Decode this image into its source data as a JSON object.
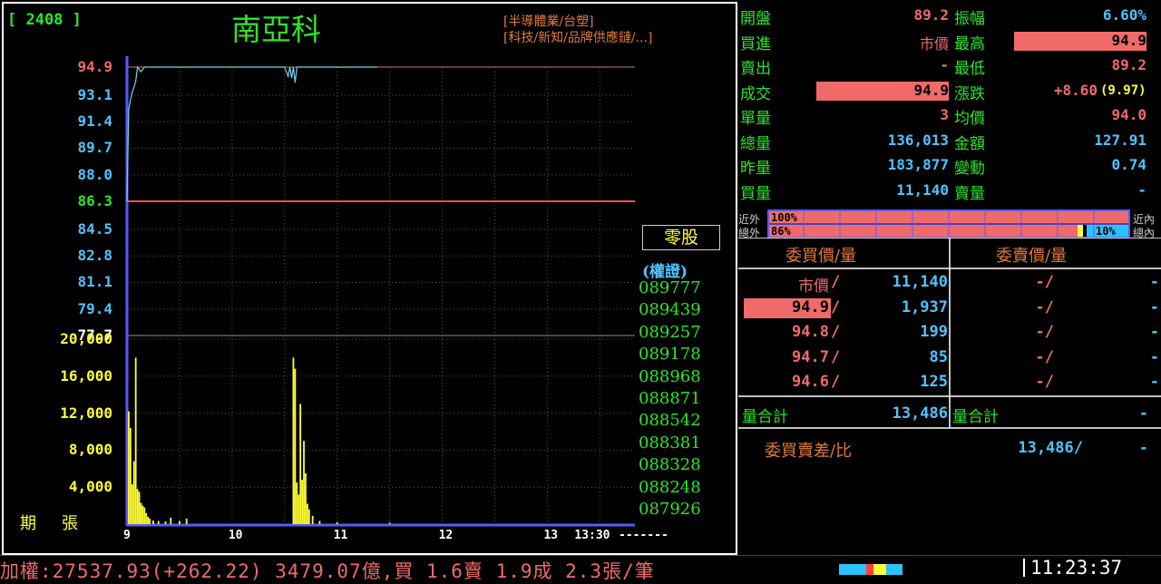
{
  "stock": {
    "code": "[ 2408 ]",
    "name": "南亞科",
    "cat1": "[半導體業/台塑]",
    "cat2": "[科技/新知/品牌供應鏈/...]"
  },
  "chart_data": {
    "type": "line",
    "y_ticks": [
      "94.9",
      "93.1",
      "91.4",
      "89.7",
      "88.0",
      "86.3",
      "84.5",
      "82.8",
      "81.1",
      "79.4",
      "77.7"
    ],
    "y_tick_colors": [
      "#f06a6a",
      "#4fc3ff",
      "#4fc3ff",
      "#4fc3ff",
      "#4fc3ff",
      "#29e629",
      "#4fc3ff",
      "#4fc3ff",
      "#4fc3ff",
      "#4fc3ff",
      "#ffffff"
    ],
    "ylim": [
      77.7,
      94.9
    ],
    "ref_price": 86.3,
    "x_ticks": [
      "9",
      "10",
      "11",
      "12",
      "13",
      "13:30"
    ],
    "x_tick_minutes": [
      0,
      60,
      120,
      180,
      240,
      270
    ],
    "xlim": [
      0,
      290
    ],
    "price_series": {
      "x": [
        0,
        1,
        2,
        3,
        4,
        5,
        6,
        8,
        10,
        20,
        40,
        60,
        80,
        90,
        92,
        93,
        94,
        95,
        96,
        97,
        98,
        100,
        110,
        130,
        143
      ],
      "y": [
        86.3,
        92.2,
        92.8,
        93.3,
        93.6,
        94.0,
        94.9,
        94.6,
        94.9,
        94.9,
        94.9,
        94.9,
        94.9,
        94.9,
        94.3,
        94.9,
        94.2,
        94.9,
        93.9,
        94.9,
        94.9,
        94.9,
        94.9,
        94.9,
        94.9
      ]
    },
    "volume_ticks": [
      "20,000",
      "16,000",
      "12,000",
      "8,000",
      "4,000"
    ],
    "volume_ylim": [
      0,
      20000
    ],
    "volume_series": {
      "x": [
        1,
        2,
        3,
        4,
        5,
        6,
        7,
        8,
        9,
        10,
        11,
        12,
        13,
        15,
        18,
        22,
        25,
        30,
        34,
        95,
        96,
        97,
        98,
        99,
        100,
        101,
        102,
        103,
        104,
        106,
        110,
        120,
        150
      ],
      "y": [
        12200,
        10400,
        4300,
        6800,
        18000,
        3800,
        3500,
        2300,
        2000,
        1800,
        1200,
        800,
        600,
        400,
        350,
        300,
        700,
        350,
        600,
        18000,
        16800,
        4500,
        3200,
        13000,
        4800,
        9000,
        5500,
        2200,
        1600,
        900,
        350,
        200,
        150
      ]
    }
  },
  "period_label": "期張",
  "odd_lot": "零股",
  "warrants_title": "(權證)",
  "warrants": [
    "089777",
    "089439",
    "089257",
    "089178",
    "088968",
    "088871",
    "088542",
    "088381",
    "088328",
    "088248",
    "087926"
  ],
  "quote": {
    "rows": [
      {
        "l1": "開盤",
        "v1": "89.2",
        "l2": "振幅",
        "v2": "6.60%",
        "c1": "#f06a6a",
        "c2": "#4fc3ff"
      },
      {
        "l1": "買進",
        "v1": "市價",
        "l2": "最高",
        "v2": "94.9",
        "c1": "#f06a6a",
        "c2": "#000000"
      },
      {
        "l1": "賣出",
        "v1": "-",
        "l2": "最低",
        "v2": "89.2",
        "c1": "#f06a6a",
        "c2": "#f06a6a"
      },
      {
        "l1": "成交",
        "v1": "94.9",
        "l2": "漲跌",
        "v2": "+8.60",
        "c1": "#000000",
        "c2": "#f06a6a"
      },
      {
        "l1": "單量",
        "v1": "3",
        "l2": "均價",
        "v2": "94.0",
        "c1": "#f06a6a",
        "c2": "#f06a6a"
      },
      {
        "l1": "總量",
        "v1": "136,013",
        "l2": "金額",
        "v2": "127.91",
        "c1": "#4fc3ff",
        "c2": "#4fc3ff"
      },
      {
        "l1": "昨量",
        "v1": "183,877",
        "l2": "變動",
        "v2": "0.74",
        "c1": "#4fc3ff",
        "c2": "#4fc3ff"
      },
      {
        "l1": "買量",
        "v1": "11,140",
        "l2": "賣量",
        "v2": "-",
        "c1": "#4fc3ff",
        "c2": "#4fc3ff"
      }
    ],
    "change_pct": "(9.97)",
    "near_out": "近外",
    "near_in": "近內",
    "total_out": "總外",
    "total_in": "總內",
    "bar1_pct": "100%",
    "bar2_pct": "86%",
    "bar2_in_pct": "10%"
  },
  "orderbook": {
    "bid_header": "委買價/量",
    "ask_header": "委賣價/量",
    "rows": [
      {
        "bid": "市價",
        "bidvol": "11,140",
        "ask": "-/",
        "askvol": "-",
        "hl": false
      },
      {
        "bid": "94.9",
        "bidvol": "1,937",
        "ask": "-/",
        "askvol": "-",
        "hl": true
      },
      {
        "bid": "94.8",
        "bidvol": "199",
        "ask": "-/",
        "askvol": "-",
        "hl": false
      },
      {
        "bid": "94.7",
        "bidvol": "85",
        "ask": "-/",
        "askvol": "-",
        "hl": false
      },
      {
        "bid": "94.6",
        "bidvol": "125",
        "ask": "-/",
        "askvol": "-",
        "hl": false
      }
    ],
    "sum_label": "量合計",
    "bid_sum": "13,486",
    "ask_sum_label": "量合計",
    "ask_sum": "-",
    "diff_label": "委買賣差/比",
    "diff_value": "13,486/",
    "diff_ratio": "-"
  },
  "ticker": "加權:27537.93(+262.22) 3479.07億,買 1.6賣 1.9成 2.3張/筆",
  "clock": "11:23:37"
}
